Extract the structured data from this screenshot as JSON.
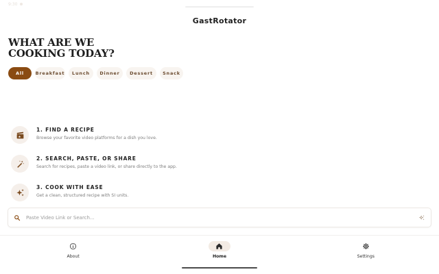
{
  "status_bar": {
    "time": "9:30"
  },
  "app": {
    "title": "GastRotator"
  },
  "headline": "WHAT ARE WE COOKING TODAY?",
  "categories": [
    {
      "label": "All",
      "active": true
    },
    {
      "label": "Breakfast",
      "active": false
    },
    {
      "label": "Lunch",
      "active": false
    },
    {
      "label": "Dinner",
      "active": false
    },
    {
      "label": "Dessert",
      "active": false
    },
    {
      "label": "Snack",
      "active": false
    }
  ],
  "steps": [
    {
      "icon": "video-clapper-icon",
      "title": "1. FIND A RECIPE",
      "description": "Browse your favorite video platforms for a dish you love."
    },
    {
      "icon": "magic-wand-icon",
      "title": "2. SEARCH, PASTE, OR SHARE",
      "description": "Search for recipes, paste a video link, or share directly to the app."
    },
    {
      "icon": "sparkles-icon",
      "title": "3. COOK WITH EASE",
      "description": "Get a clean, structured recipe with SI units."
    }
  ],
  "search": {
    "placeholder": "Paste Video Link or Search..."
  },
  "bottom_nav": [
    {
      "label": "About",
      "icon": "info-icon",
      "active": false
    },
    {
      "label": "Home",
      "icon": "home-icon",
      "active": true
    },
    {
      "label": "Settings",
      "icon": "gear-icon",
      "active": false
    }
  ],
  "colors": {
    "accent": "#8a4b12",
    "chip_bg": "#f8f4f0",
    "icon_bg": "#f5efea"
  }
}
